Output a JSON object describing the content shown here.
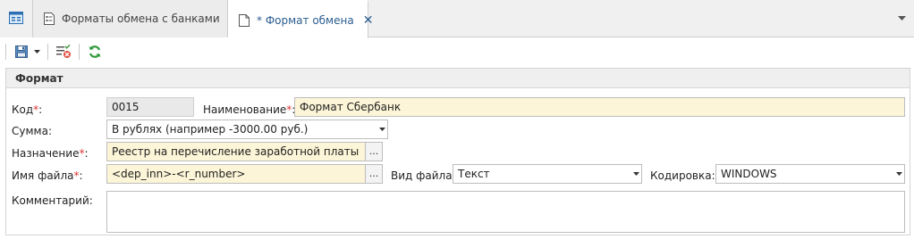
{
  "tabs": [
    {
      "label": "Форматы обмена с банками",
      "icon": "document-list-icon",
      "active": false
    },
    {
      "label": "* Формат обмена",
      "icon": "document-icon",
      "active": true
    }
  ],
  "section": {
    "title": "Формат"
  },
  "form": {
    "code": {
      "label": "Код",
      "value": "0015"
    },
    "name": {
      "label": "Наименование",
      "value": "Формат Сбербанк"
    },
    "sum": {
      "label": "Сумма:",
      "value": "В рублях (например -3000.00 руб.)"
    },
    "purpose": {
      "label": "Назначение",
      "value": "Реестр на перечисление заработной платы"
    },
    "filename": {
      "label": "Имя файла",
      "value": "<dep_inn>-<r_number>"
    },
    "filetype": {
      "label": "Вид файла:",
      "value": "Текст"
    },
    "encoding": {
      "label": "Кодировка:",
      "value": "WINDOWS"
    },
    "comment": {
      "label": "Комментарий:",
      "value": ""
    }
  },
  "ui": {
    "required_mark": "*",
    "colon": ":",
    "ellipsis": "..."
  },
  "colors": {
    "accent": "#2a5d8f",
    "required_bg": "#fdf5d7",
    "required_mark": "#d33333",
    "readonly_bg": "#e9e9e9"
  }
}
